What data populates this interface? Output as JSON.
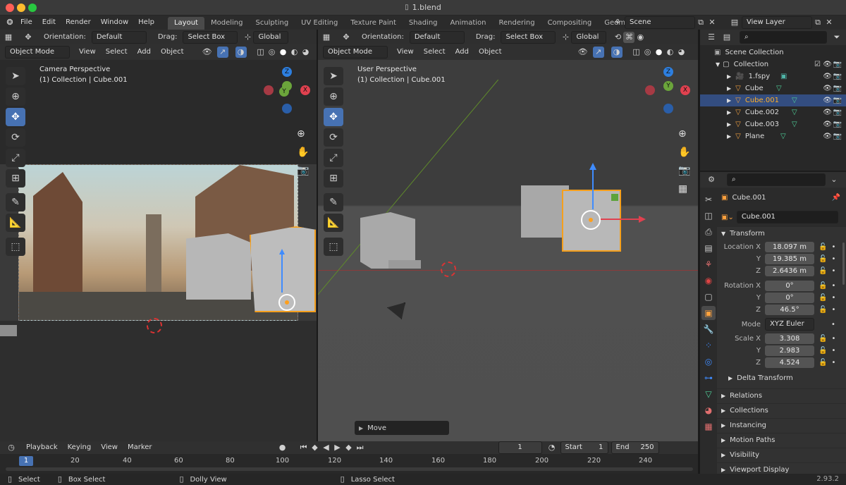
{
  "window": {
    "title": "1.blend"
  },
  "menu": [
    "File",
    "Edit",
    "Render",
    "Window",
    "Help"
  ],
  "workspaces": [
    "Layout",
    "Modeling",
    "Sculpting",
    "UV Editing",
    "Texture Paint",
    "Shading",
    "Animation",
    "Rendering",
    "Compositing",
    "Geometry Nodes"
  ],
  "scene": {
    "name": "Scene",
    "view_layer": "View Layer"
  },
  "tool_header": {
    "orientation_label": "Orientation:",
    "orientation_value": "Default",
    "drag_label": "Drag:",
    "drag_value": "Select Box",
    "transform_value": "Global"
  },
  "viewport_header": {
    "mode": "Object Mode",
    "items": [
      "View",
      "Select",
      "Add",
      "Object"
    ]
  },
  "viewport_left": {
    "perspective": "Camera Perspective",
    "context": "(1) Collection | Cube.001"
  },
  "viewport_right": {
    "perspective": "User Perspective",
    "context": "(1) Collection | Cube.001",
    "operator": "Move"
  },
  "axes": {
    "x": "X",
    "y": "Y",
    "z": "Z"
  },
  "outliner": {
    "root": "Scene Collection",
    "collection": "Collection",
    "items": [
      {
        "name": "1.fspy",
        "selected": false
      },
      {
        "name": "Cube",
        "selected": false
      },
      {
        "name": "Cube.001",
        "selected": true
      },
      {
        "name": "Cube.002",
        "selected": false
      },
      {
        "name": "Cube.003",
        "selected": false
      },
      {
        "name": "Plane",
        "selected": false
      }
    ]
  },
  "properties": {
    "object_name": "Cube.001",
    "object_field": "Cube.001",
    "transform_label": "Transform",
    "location_label": "Location X",
    "rotation_label": "Rotation X",
    "scale_label": "Scale X",
    "y_label": "Y",
    "z_label": "Z",
    "location": [
      "18.097 m",
      "19.385 m",
      "2.6436 m"
    ],
    "rotation": [
      "0°",
      "0°",
      "46.5°"
    ],
    "mode_label": "Mode",
    "mode_value": "XYZ Euler",
    "scale": [
      "3.308",
      "2.983",
      "4.524"
    ],
    "delta_transform": "Delta Transform",
    "sections": [
      "Relations",
      "Collections",
      "Instancing",
      "Motion Paths",
      "Visibility",
      "Viewport Display"
    ]
  },
  "timeline": {
    "menus": [
      "Playback",
      "Keying",
      "View",
      "Marker"
    ],
    "current_frame": "1",
    "start_label": "Start",
    "start": "1",
    "end_label": "End",
    "end": "250",
    "ticks": [
      "20",
      "40",
      "60",
      "80",
      "100",
      "120",
      "140",
      "160",
      "180",
      "200",
      "220",
      "240"
    ],
    "playhead": "1"
  },
  "status": {
    "select": "Select",
    "box_select": "Box Select",
    "dolly": "Dolly View",
    "lasso": "Lasso Select",
    "version": "2.93.2"
  },
  "colors": {
    "accent": "#4772b3",
    "selected_orange": "#ffaf29",
    "axis_x": "#e0414f",
    "axis_y": "#6ba53b",
    "axis_z": "#2d7fe0"
  }
}
